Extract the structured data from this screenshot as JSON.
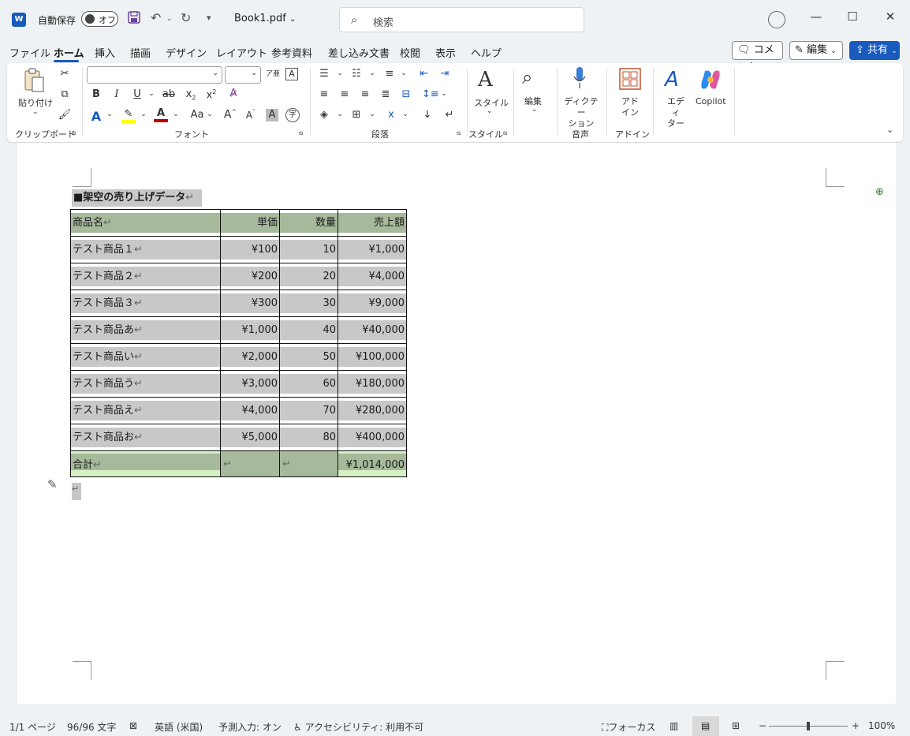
{
  "titlebar": {
    "autosave_label": "自動保存",
    "autosave_state": "オフ",
    "filename": "Book1.pdf",
    "search_placeholder": "検索"
  },
  "menu": {
    "tabs": [
      "ファイル",
      "ホーム",
      "挿入",
      "描画",
      "デザイン",
      "レイアウト",
      "参考資料",
      "差し込み文書",
      "校閲",
      "表示",
      "ヘルプ"
    ],
    "active_tab": "ホーム",
    "comment_label": "コメント",
    "edit_label": "編集",
    "share_label": "共有"
  },
  "ribbon": {
    "paste_label": "貼り付け",
    "group_clipboard": "クリップボード",
    "group_font": "フォント",
    "group_paragraph": "段落",
    "group_style": "スタイル",
    "group_voice": "音声",
    "group_addin": "アドイン",
    "style_label": "スタイル",
    "edit_label": "編集",
    "dictate_label": "ディクテー\nション",
    "addin_label": "アド\nイン",
    "editor_label": "エディ\nター",
    "copilot_label": "Copilot",
    "font_name": "",
    "font_size": ""
  },
  "document": {
    "heading": "■架空の売り上げデータ",
    "columns": [
      "商品名",
      "単価",
      "数量",
      "売上額"
    ],
    "rows": [
      [
        "テスト商品１",
        "¥100",
        "10",
        "¥1,000"
      ],
      [
        "テスト商品２",
        "¥200",
        "20",
        "¥4,000"
      ],
      [
        "テスト商品３",
        "¥300",
        "30",
        "¥9,000"
      ],
      [
        "テスト商品あ",
        "¥1,000",
        "40",
        "¥40,000"
      ],
      [
        "テスト商品い",
        "¥2,000",
        "50",
        "¥100,000"
      ],
      [
        "テスト商品う",
        "¥3,000",
        "60",
        "¥180,000"
      ],
      [
        "テスト商品え",
        "¥4,000",
        "70",
        "¥280,000"
      ],
      [
        "テスト商品お",
        "¥5,000",
        "80",
        "¥400,000"
      ]
    ],
    "total": [
      "合計",
      "",
      "",
      "¥1,014,000"
    ],
    "para_mark": "↵"
  },
  "status": {
    "page": "1/1 ページ",
    "words": "96/96 文字",
    "language": "英語 (米国)",
    "predict": "予測入力: オン",
    "accessibility": "アクセシビリティ: 利用不可",
    "focus": "フォーカス",
    "zoom": "100%"
  },
  "colors": {
    "accent": "#185abd",
    "cell_shade": "#c8c8c8",
    "header_shade": "#a6b99b",
    "total_highlight": "#d4f0c4"
  }
}
